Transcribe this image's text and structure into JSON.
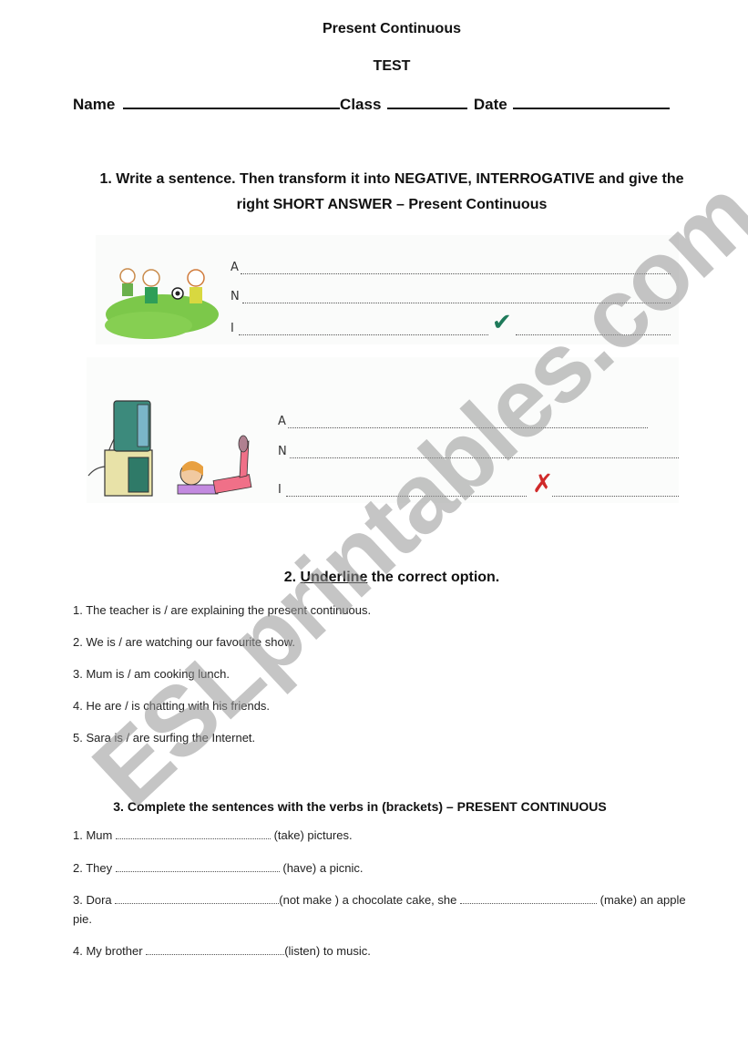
{
  "header": {
    "title": "Present Continuous",
    "subtitle": "TEST",
    "name_label": "Name",
    "class_label": "Class",
    "date_label": "Date"
  },
  "exercise1": {
    "heading_line1": "1. Write a sentence. Then transform it into NEGATIVE, INTERROGATIVE and give the",
    "heading_line2": "right SHORT ANSWER – Present Continuous",
    "labels": {
      "affirmative": "A",
      "negative": "N",
      "interrogative": "I"
    },
    "items": [
      {
        "picture": "children-playing-football",
        "short_answer_mark": "✔",
        "short_answer_meaning": "yes"
      },
      {
        "picture": "girl-watching-tv",
        "short_answer_mark": "✗",
        "short_answer_meaning": "no"
      }
    ]
  },
  "exercise2": {
    "heading_number": "2.",
    "heading_underlined": "Underline",
    "heading_rest": "the correct option.",
    "items": [
      "1. The teacher is / are explaining the present continuous.",
      "2. We is / are watching our favourite show.",
      "3. Mum is / am cooking lunch.",
      "4. He are / is chatting with his friends.",
      "5. Sara is / are surfing the Internet."
    ]
  },
  "exercise3": {
    "heading": "3. Complete the sentences with the verbs in (brackets) – PRESENT CONTINUOUS",
    "items": [
      {
        "before": "1. Mum",
        "verb": "(take) pictures."
      },
      {
        "before": "2. They",
        "verb": "(have) a picnic."
      },
      {
        "before": "3. Dora",
        "verb": "(not make ) a chocolate cake, she",
        "verb2": "(make) an apple",
        "wrap": "pie."
      },
      {
        "before": "4. My brother",
        "verb": "(listen) to music."
      }
    ]
  },
  "watermark": "ESLprintables.com",
  "colors": {
    "check": "#1e7a5a",
    "cross": "#d02a2a",
    "grass": "#7cc84a",
    "watermark": "#969696"
  }
}
